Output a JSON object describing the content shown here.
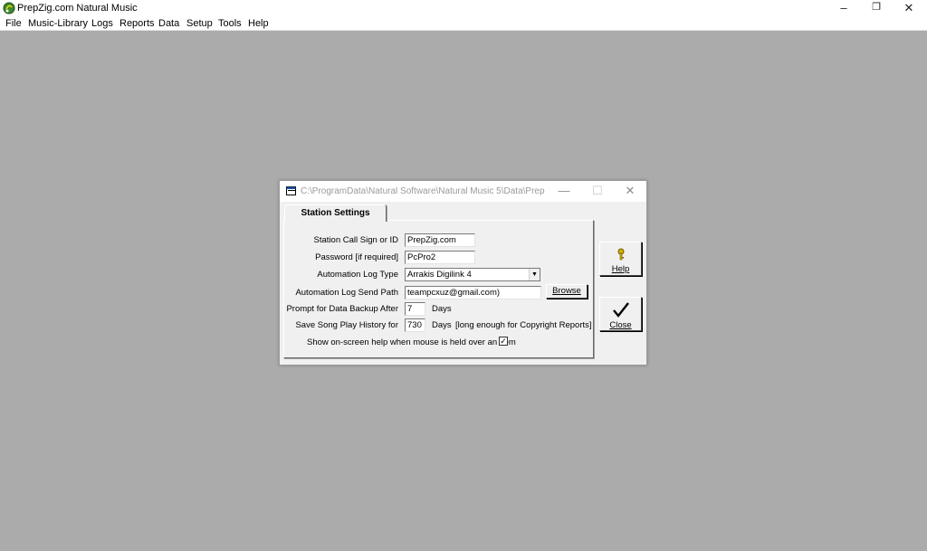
{
  "app": {
    "title": "PrepZig.com Natural Music",
    "icon": "natural-music-app-icon",
    "controls": {
      "minimize": "–",
      "restore": "❐",
      "close": "✕"
    }
  },
  "menubar": {
    "items": [
      {
        "label": "File"
      },
      {
        "label": "Music-Library"
      },
      {
        "label": "Logs"
      },
      {
        "label": "Reports"
      },
      {
        "label": "Data"
      },
      {
        "label": "Setup"
      },
      {
        "label": "Tools"
      },
      {
        "label": "Help"
      }
    ]
  },
  "dialog": {
    "title": "C:\\ProgramData\\Natural Software\\Natural Music 5\\Data\\Prep...",
    "controls": {
      "minimize": "—",
      "maximize": "☐",
      "close": "✕"
    },
    "tab_label": "Station Settings",
    "fields": {
      "call_sign": {
        "label": "Station Call Sign or ID",
        "value": "PrepZig.com"
      },
      "password": {
        "label": "Password [if required]",
        "value": "PcPro2"
      },
      "log_type": {
        "label": "Automation Log Type",
        "value": "Arrakis Digilink 4"
      },
      "send_path": {
        "label": "Automation Log Send Path",
        "value": "teampcxuz@gmail.com)"
      },
      "backup": {
        "label": "Prompt for Data Backup After",
        "value": "7",
        "unit": "Days"
      },
      "history": {
        "label": "Save Song Play History for",
        "value": "730",
        "unit": "Days",
        "note": "[long enough for Copyright Reports]"
      },
      "help_toggle": {
        "label": "Show on-screen help when mouse is held over an item",
        "checked": true,
        "glyph": "✓"
      }
    },
    "browse_label": "Browse",
    "help_button": {
      "label": "Help",
      "icon": "key-icon"
    },
    "close_button": {
      "label": "Close",
      "icon": "checkmark-icon"
    }
  },
  "colors": {
    "workspace": "#ababab",
    "dialog_bg": "#f0f0f0",
    "help_icon": "#d4b000"
  }
}
